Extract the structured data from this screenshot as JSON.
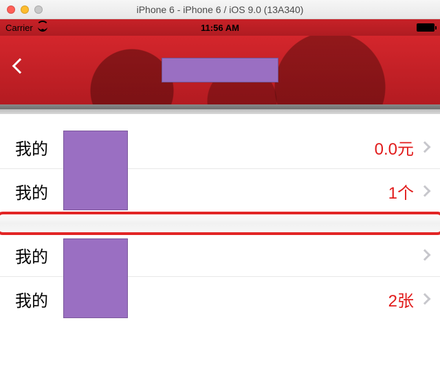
{
  "window": {
    "title": "iPhone 6 - iPhone 6 / iOS 9.0 (13A340)"
  },
  "status": {
    "carrier": "Carrier",
    "time": "11:56 AM"
  },
  "nav": {
    "title_placeholder": ""
  },
  "sections": [
    {
      "rows": [
        {
          "label": "我的",
          "value": "0.0元"
        },
        {
          "label": "我的",
          "value": "1个"
        }
      ]
    },
    {
      "rows": [
        {
          "label": "我的",
          "value": ""
        },
        {
          "label": "我的",
          "value": "2张"
        }
      ]
    }
  ]
}
